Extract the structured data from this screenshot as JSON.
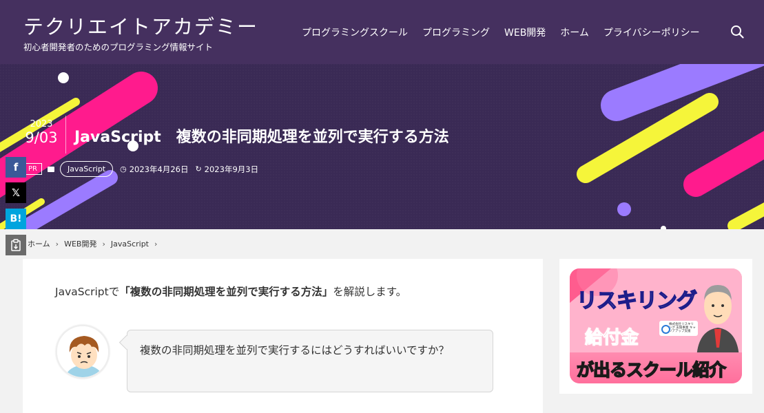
{
  "site": {
    "logo": "テクリエイトアカデミー",
    "tagline": "初心者開発者のためのプログラミング情報サイト"
  },
  "nav": {
    "items": [
      "プログラミングスクール",
      "プログラミング",
      "WEB開発",
      "ホーム",
      "プライバシーポリシー"
    ],
    "search_icon": "search-icon"
  },
  "post": {
    "year": "2023",
    "month_day": "9/03",
    "title": "JavaScript　複数の非同期処理を並列で実行する方法",
    "pr_label": "PR",
    "category": "JavaScript",
    "published": "2023年4月26日",
    "updated": "2023年9月3日"
  },
  "share": {
    "facebook": "f",
    "x": "𝕏",
    "hatena": "B!",
    "copy_icon": "copy-icon"
  },
  "breadcrumb": {
    "items": [
      "ホーム",
      "WEB開発",
      "JavaScript"
    ]
  },
  "content": {
    "intro_prefix": "JavaScriptで",
    "intro_bold": "「複数の非同期処理を並列で実行する方法」",
    "intro_suffix": "を解説します。",
    "bubble_text": "複数の非同期処理を並列で実行するにはどうすればいいですか？"
  },
  "sidebar": {
    "banner_line1": "リスキリング",
    "banner_line2": "給付金",
    "banner_line3": "が出るスクール紹介",
    "banner_badge": "株式会社リスキリング 支援事業 キャリアアップ支援"
  },
  "colors": {
    "header_bg": "#45305f",
    "hero_bg": "#3a2a55",
    "pink": "#ff1b8d",
    "yellow": "#f5f53a",
    "purple": "#9b7bff"
  }
}
